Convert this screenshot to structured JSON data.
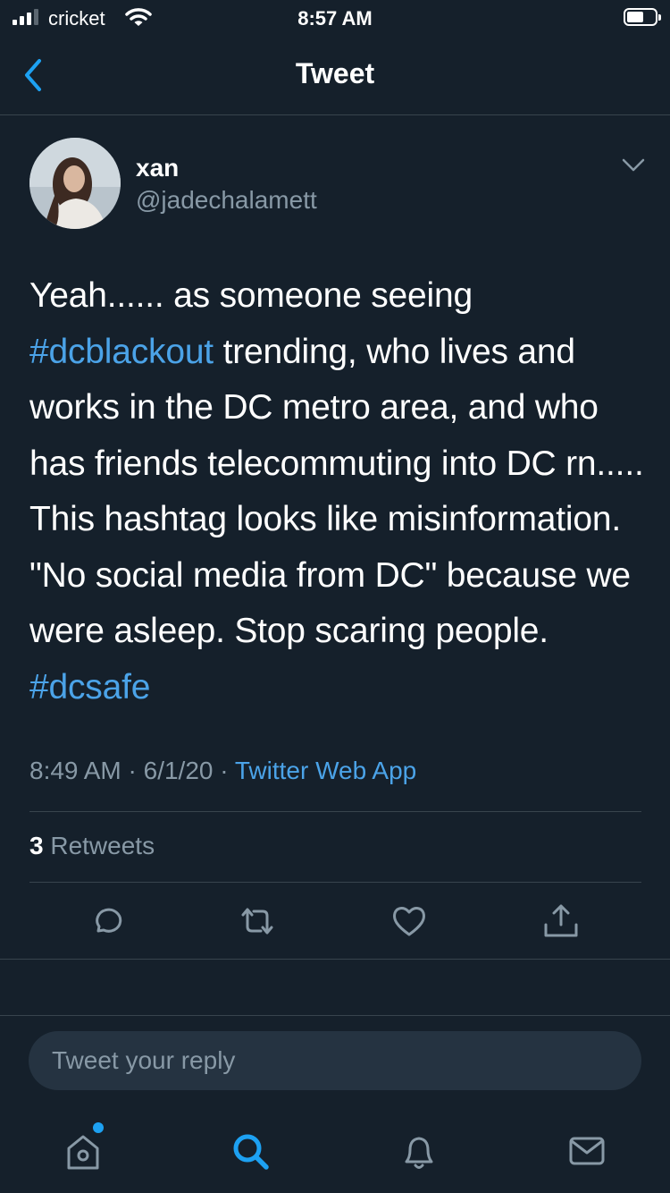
{
  "status_bar": {
    "carrier": "cricket",
    "time": "8:57 AM"
  },
  "nav": {
    "title": "Tweet",
    "back_icon": "chevron-left-icon"
  },
  "tweet": {
    "display_name": "xan",
    "handle": "@jadechalamett",
    "text_parts": {
      "p1": "Yeah...... as someone seeing ",
      "tag1": "#dcblackout",
      "p2": " trending, who lives and works in the DC metro area, and who has friends telecommuting into DC rn..... This hashtag looks like misinformation. \"No social media from DC\" because we were asleep. Stop scaring people. ",
      "tag2": "#dcsafe"
    },
    "time": "8:49 AM",
    "sep1": " · ",
    "date": "6/1/20",
    "sep2": " · ",
    "source": "Twitter Web App",
    "retweet_count": "3",
    "retweet_label": " Retweets"
  },
  "actions": [
    "reply-icon",
    "retweet-icon",
    "like-icon",
    "share-icon"
  ],
  "reply": {
    "placeholder": "Tweet your reply"
  },
  "tabbar": [
    "home-icon",
    "search-icon",
    "notifications-icon",
    "messages-icon"
  ],
  "colors": {
    "background": "#15202b",
    "accent": "#1da1f2",
    "link": "#4ba3e8",
    "muted": "#8899a6",
    "divider": "#38444d"
  }
}
